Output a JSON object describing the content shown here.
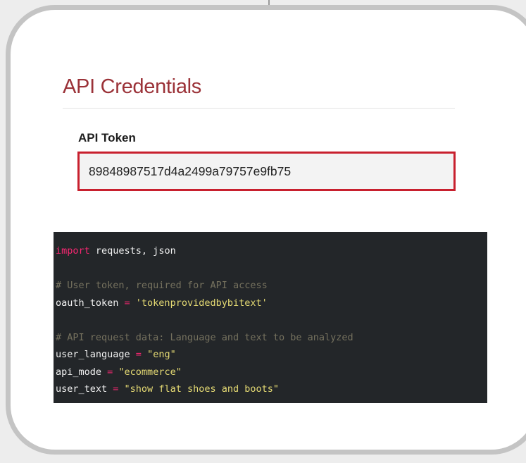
{
  "section": {
    "title": "API Credentials"
  },
  "token_field": {
    "label": "API Token",
    "value": "89848987517d4a2499a79757e9fb75"
  },
  "code": {
    "line1": {
      "keyword": "import",
      "rest": " requests, json"
    },
    "line3": {
      "comment": "# User token, required for API access"
    },
    "line4": {
      "var": "oauth_token",
      "op": " = ",
      "str": "'tokenprovidedbybitext'"
    },
    "line6": {
      "comment": "# API request data: Language and text to be analyzed"
    },
    "line7": {
      "var": "user_language",
      "op": " = ",
      "str": "\"eng\""
    },
    "line8": {
      "var": "api_mode",
      "op": " = ",
      "str": "\"ecommerce\""
    },
    "line9": {
      "var": "user_text",
      "op": " = ",
      "str": "\"show flat shoes and boots\""
    }
  },
  "colors": {
    "title": "#9b3238",
    "token_border": "#c8202e",
    "code_bg": "#232629",
    "code_keyword": "#f92672",
    "code_string": "#e6db74",
    "code_comment": "#75715e"
  }
}
